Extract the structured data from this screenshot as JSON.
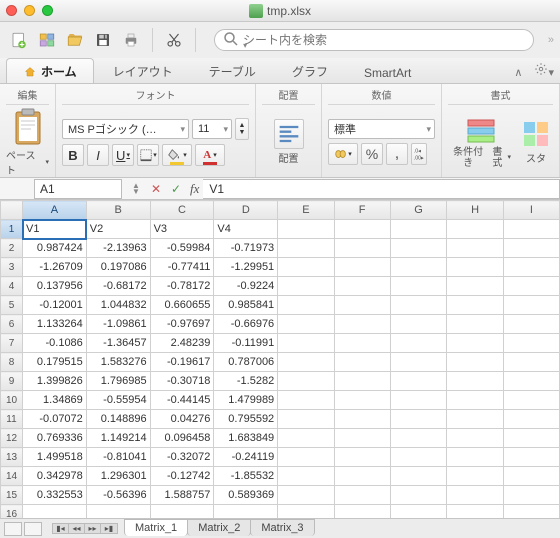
{
  "window": {
    "filename": "tmp.xlsx"
  },
  "search": {
    "placeholder": "シート内を検索"
  },
  "tabs": {
    "home": "ホーム",
    "layout": "レイアウト",
    "tables": "テーブル",
    "charts": "グラフ",
    "smartart": "SmartArt"
  },
  "ribbon": {
    "edit_group": "編集",
    "font_group": "フォント",
    "align_group": "配置",
    "number_group": "数値",
    "format_group": "書式",
    "paste": "ペースト",
    "align": "配置",
    "cond_format_l1": "条件付き",
    "cond_format_l2": "書式",
    "style_l1": "スタ",
    "font_name": "MS Pゴシック (…",
    "font_size": "11",
    "number_format": "標準"
  },
  "formula_bar": {
    "name_box": "A1",
    "formula": "V1"
  },
  "columns": [
    "A",
    "B",
    "C",
    "D",
    "E",
    "F",
    "G",
    "H",
    "I"
  ],
  "headers": [
    "V1",
    "V2",
    "V3",
    "V4"
  ],
  "rows": [
    [
      "0.987424",
      "-2.13963",
      "-0.59984",
      "-0.71973"
    ],
    [
      "-1.26709",
      "0.197086",
      "-0.77411",
      "-1.29951"
    ],
    [
      "0.137956",
      "-0.68172",
      "-0.78172",
      "-0.9224"
    ],
    [
      "-0.12001",
      "1.044832",
      "0.660655",
      "0.985841"
    ],
    [
      "1.133264",
      "-1.09861",
      "-0.97697",
      "-0.66976"
    ],
    [
      "-0.1086",
      "-1.36457",
      "2.48239",
      "-0.11991"
    ],
    [
      "0.179515",
      "1.583276",
      "-0.19617",
      "0.787006"
    ],
    [
      "1.399826",
      "1.796985",
      "-0.30718",
      "-1.5282"
    ],
    [
      "1.34869",
      "-0.55954",
      "-0.44145",
      "1.479989"
    ],
    [
      "-0.07072",
      "0.148896",
      "0.04276",
      "0.795592"
    ],
    [
      "0.769336",
      "1.149214",
      "0.096458",
      "1.683849"
    ],
    [
      "1.499518",
      "-0.81041",
      "-0.32072",
      "-0.24119"
    ],
    [
      "0.342978",
      "1.296301",
      "-0.12742",
      "-1.85532"
    ],
    [
      "0.332553",
      "-0.56396",
      "1.588757",
      "0.589369"
    ]
  ],
  "sheet_tabs": [
    "Matrix_1",
    "Matrix_2",
    "Matrix_3"
  ],
  "icons": {
    "bold": "B",
    "italic": "I",
    "underline": "U"
  }
}
